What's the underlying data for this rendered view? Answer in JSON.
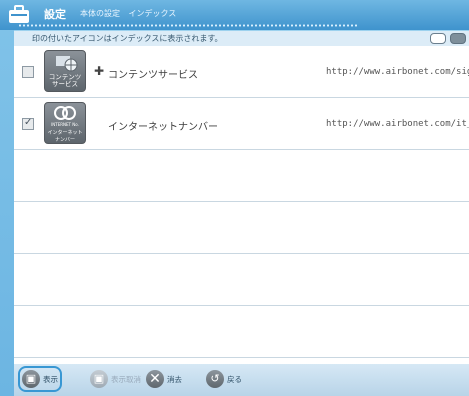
{
  "window": {
    "title": "設定",
    "breadcrumb": [
      "本体の設定",
      "インデックス"
    ]
  },
  "subbar": {
    "note": "印の付いたアイコンはインデックスに表示されます。"
  },
  "items": [
    {
      "checked": false,
      "icon_name": "contents-service-icon",
      "icon_label": "コンテンツ\nサービス",
      "has_plus": true,
      "name": "コンテンツサービス",
      "url": "http://www.airbonet.com/sign"
    },
    {
      "checked": true,
      "icon_name": "internet-number-icon",
      "icon_label": "インターネットナンバー",
      "icon_caption_top": "INTERNET No.",
      "has_plus": false,
      "name": "インターネットナンバー",
      "url": "http://www.airbonet.com/it_t"
    }
  ],
  "toolbar": {
    "show_label": "表示",
    "hide_label": "表示取消",
    "delete_label": "消去",
    "back_label": "戻る"
  }
}
